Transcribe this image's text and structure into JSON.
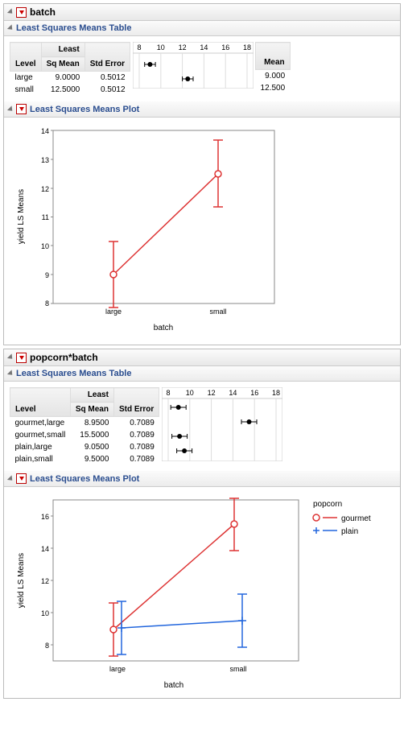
{
  "section1": {
    "title": "batch",
    "table_title": "Least Squares Means Table",
    "plot_title": "Least Squares Means Plot",
    "columns": {
      "c1": "Level",
      "c2a": "Least",
      "c2b": "Sq Mean",
      "c3": "Std Error",
      "c4": "Mean"
    },
    "rows": [
      {
        "level": "large",
        "lsmean": "9.0000",
        "stderr": "0.5012",
        "mean": "9.000"
      },
      {
        "level": "small",
        "lsmean": "12.5000",
        "stderr": "0.5012",
        "mean": "12.500"
      }
    ],
    "mini_ticks": [
      "8",
      "10",
      "12",
      "14",
      "16",
      "18"
    ],
    "yticks": [
      "14",
      "13",
      "12",
      "11",
      "10",
      "9",
      "8"
    ],
    "xlabel": "batch",
    "ylabel": "yield LS Means",
    "xcats": [
      "large",
      "small"
    ]
  },
  "section2": {
    "title": "popcorn*batch",
    "table_title": "Least Squares Means Table",
    "plot_title": "Least Squares Means Plot",
    "columns": {
      "c1": "Level",
      "c2a": "Least",
      "c2b": "Sq Mean",
      "c3": "Std Error"
    },
    "rows": [
      {
        "level": "gourmet,large",
        "lsmean": "8.9500",
        "stderr": "0.7089"
      },
      {
        "level": "gourmet,small",
        "lsmean": "15.5000",
        "stderr": "0.7089"
      },
      {
        "level": "plain,large",
        "lsmean": "9.0500",
        "stderr": "0.7089"
      },
      {
        "level": "plain,small",
        "lsmean": "9.5000",
        "stderr": "0.7089"
      }
    ],
    "mini_ticks": [
      "8",
      "10",
      "12",
      "14",
      "16",
      "18"
    ],
    "yticks": [
      "16",
      "14",
      "12",
      "10",
      "8"
    ],
    "xlabel": "batch",
    "ylabel": "yield LS Means",
    "xcats": [
      "large",
      "small"
    ],
    "legend_title": "popcorn",
    "legend": [
      "gourmet",
      "plain"
    ]
  },
  "chart_data": [
    {
      "type": "line",
      "title": "Least Squares Means Plot (batch)",
      "xlabel": "batch",
      "ylabel": "yield LS Means",
      "categories": [
        "large",
        "small"
      ],
      "series": [
        {
          "name": "yield LS Mean",
          "values": [
            9.0,
            12.5
          ],
          "stderr": [
            0.5012,
            0.5012
          ],
          "ci_half": [
            1.15,
            1.15
          ]
        }
      ],
      "ylim": [
        8,
        14
      ]
    },
    {
      "type": "line",
      "title": "Least Squares Means Plot (popcorn*batch)",
      "xlabel": "batch",
      "ylabel": "yield LS Means",
      "categories": [
        "large",
        "small"
      ],
      "series": [
        {
          "name": "gourmet",
          "values": [
            8.95,
            15.5
          ],
          "stderr": [
            0.7089,
            0.7089
          ],
          "ci_half": [
            1.63,
            1.63
          ]
        },
        {
          "name": "plain",
          "values": [
            9.05,
            9.5
          ],
          "stderr": [
            0.7089,
            0.7089
          ],
          "ci_half": [
            1.63,
            1.63
          ]
        }
      ],
      "ylim": [
        7,
        17
      ]
    }
  ]
}
